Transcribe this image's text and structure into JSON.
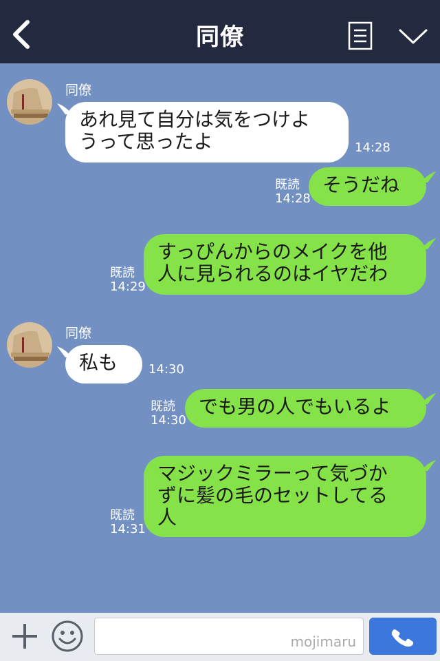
{
  "header": {
    "title": "同僚",
    "back_icon": "chevron-left-icon",
    "menu_icon": "menu-icon",
    "collapse_icon": "chevron-down-icon"
  },
  "messages": [
    {
      "side": "left",
      "sender": "同僚",
      "lines": [
        "あれ見て自分は気をつけよ",
        "うって思ったよ"
      ],
      "time": "14:28"
    },
    {
      "side": "right",
      "read": "既読",
      "time": "14:28",
      "lines": [
        "そうだね"
      ]
    },
    {
      "side": "right",
      "read": "既読",
      "time": "14:29",
      "lines": [
        "すっぴんからのメイクを他",
        "人に見られるのはイヤだわ"
      ]
    },
    {
      "side": "left",
      "sender": "同僚",
      "lines": [
        "私も"
      ],
      "time": "14:30"
    },
    {
      "side": "right",
      "read": "既読",
      "time": "14:30",
      "lines": [
        "でも男の人でもいるよ"
      ]
    },
    {
      "side": "right",
      "read": "既読",
      "time": "14:31",
      "lines": [
        "マジックミラーって気づか",
        "ずに髪の毛のセットしてる",
        "人"
      ]
    }
  ],
  "footer": {
    "plus_icon": "plus-icon",
    "emoji_icon": "smiley-icon",
    "input_placeholder": "mojimaru",
    "call_icon": "phone-icon"
  },
  "colors": {
    "header_bg": "#232a3f",
    "chat_bg": "#7290c2",
    "my_bubble": "#85e249",
    "their_bubble": "#ffffff",
    "call_button": "#3c77de"
  }
}
